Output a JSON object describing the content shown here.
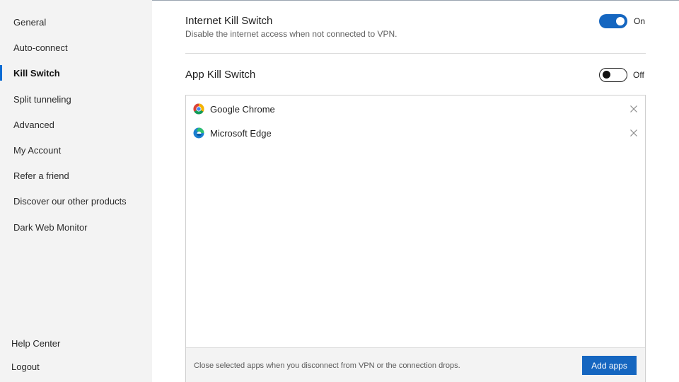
{
  "sidebar": {
    "items": [
      {
        "label": "General"
      },
      {
        "label": "Auto-connect"
      },
      {
        "label": "Kill Switch",
        "active": true
      },
      {
        "label": "Split tunneling"
      },
      {
        "label": "Advanced"
      },
      {
        "label": "My Account"
      },
      {
        "label": "Refer a friend"
      },
      {
        "label": "Discover our other products"
      },
      {
        "label": "Dark Web Monitor"
      }
    ],
    "bottom": {
      "help": "Help Center",
      "logout": "Logout"
    }
  },
  "internet_kill_switch": {
    "title": "Internet Kill Switch",
    "description": "Disable the internet access when not connected to VPN.",
    "state": "On"
  },
  "app_kill_switch": {
    "title": "App Kill Switch",
    "state": "Off",
    "apps": [
      {
        "name": "Google Chrome",
        "icon": "chrome-icon"
      },
      {
        "name": "Microsoft Edge",
        "icon": "edge-icon"
      }
    ],
    "footer_text": "Close selected apps when you disconnect from VPN or the connection drops.",
    "add_button": "Add apps"
  },
  "colors": {
    "accent": "#1566c0",
    "active_indicator": "#0a6cd4",
    "sidebar_bg": "#f3f3f3"
  }
}
